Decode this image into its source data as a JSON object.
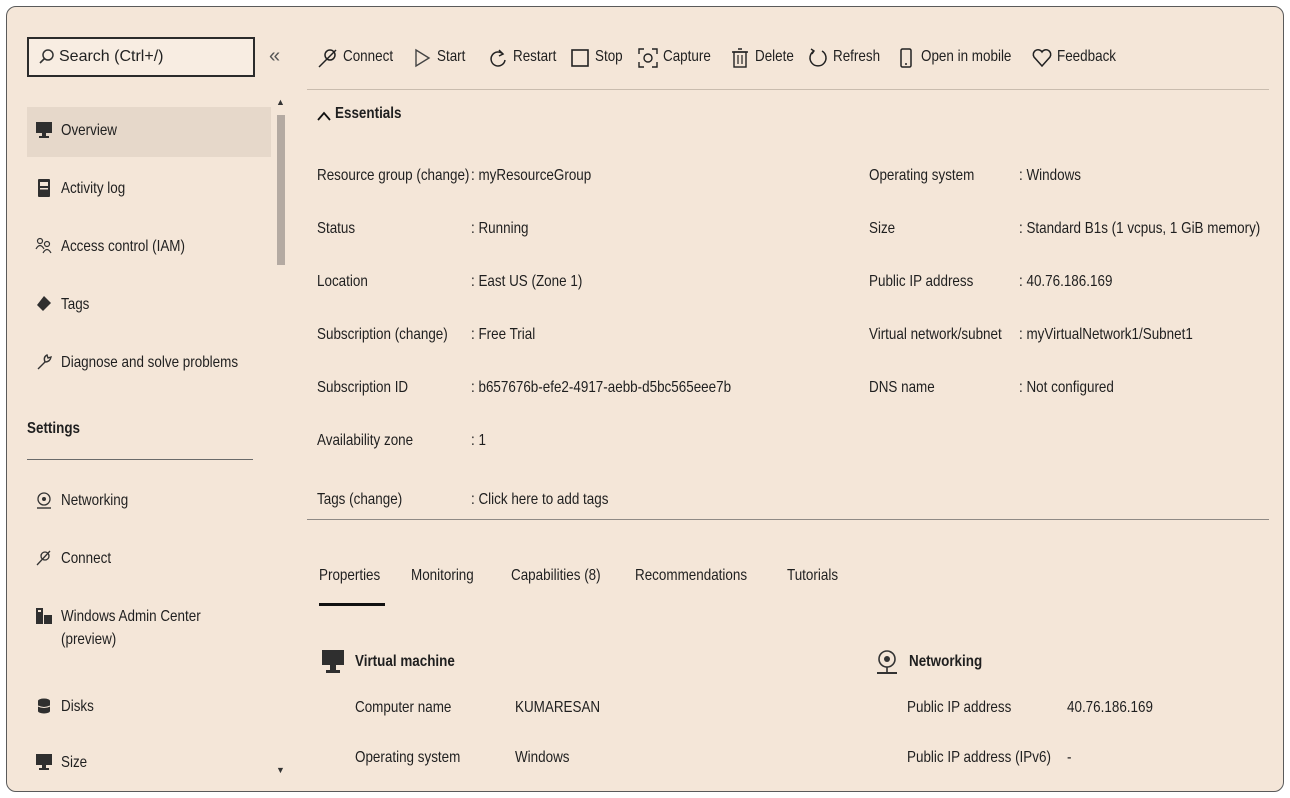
{
  "search": {
    "placeholder": "Search (Ctrl+/)"
  },
  "sidebar": {
    "collapse_glyph": "«",
    "items": [
      {
        "label": "Overview",
        "icon": "monitor-icon",
        "active": true
      },
      {
        "label": "Activity log",
        "icon": "log-icon"
      },
      {
        "label": "Access control (IAM)",
        "icon": "people-icon"
      },
      {
        "label": "Tags",
        "icon": "tag-icon"
      },
      {
        "label": "Diagnose and solve problems",
        "icon": "wrench-icon"
      }
    ],
    "settings_heading": "Settings",
    "settings_items": [
      {
        "label": "Networking",
        "icon": "network-icon"
      },
      {
        "label": "Connect",
        "icon": "connect-icon"
      },
      {
        "label": "Windows Admin Center",
        "label2": "(preview)",
        "icon": "admin-center-icon"
      },
      {
        "label": "Disks",
        "icon": "disk-icon"
      },
      {
        "label": "Size",
        "icon": "monitor-icon"
      }
    ]
  },
  "toolbar": {
    "connect": "Connect",
    "start": "Start",
    "restart": "Restart",
    "stop": "Stop",
    "capture": "Capture",
    "delete": "Delete",
    "refresh": "Refresh",
    "open_mobile": "Open in mobile",
    "feedback": "Feedback"
  },
  "essentials": {
    "title": "Essentials",
    "left": [
      {
        "key": "Resource group (change)",
        "value": ": myResourceGroup"
      },
      {
        "key": "Status",
        "value": ": Running"
      },
      {
        "key": "Location",
        "value": ": East US (Zone 1)"
      },
      {
        "key": "Subscription (change)",
        "value": ": Free Trial"
      },
      {
        "key": "Subscription ID",
        "value": ": b657676b-efe2-4917-aebb-d5bc565eee7b"
      },
      {
        "key": "Availability zone",
        "value": ": 1"
      },
      {
        "key": "Tags (change)",
        "value": ": Click here to add tags"
      }
    ],
    "right": [
      {
        "key": "Operating system",
        "value": ": Windows"
      },
      {
        "key": "Size",
        "value": ": Standard B1s (1 vcpus, 1 GiB memory)"
      },
      {
        "key": "Public IP address",
        "value": ": 40.76.186.169"
      },
      {
        "key": "Virtual network/subnet",
        "value": ": myVirtualNetwork1/Subnet1"
      },
      {
        "key": "DNS name",
        "value": ": Not configured"
      }
    ]
  },
  "tabs": [
    {
      "label": "Properties",
      "active": true
    },
    {
      "label": "Monitoring"
    },
    {
      "label": "Capabilities (8)"
    },
    {
      "label": "Recommendations"
    },
    {
      "label": "Tutorials"
    }
  ],
  "properties": {
    "vm": {
      "title": "Virtual machine",
      "rows": [
        {
          "key": "Computer name",
          "value": "KUMARESAN"
        },
        {
          "key": "Operating system",
          "value": "Windows"
        }
      ]
    },
    "networking": {
      "title": "Networking",
      "rows": [
        {
          "key": "Public IP address",
          "value": "40.76.186.169"
        },
        {
          "key": "Public IP address (IPv6)",
          "value": "-"
        }
      ]
    }
  },
  "colors": {
    "panel_bg": "#f4e6d8",
    "active_item_bg": "#e6d8ca",
    "text": "#1f1f1f"
  }
}
